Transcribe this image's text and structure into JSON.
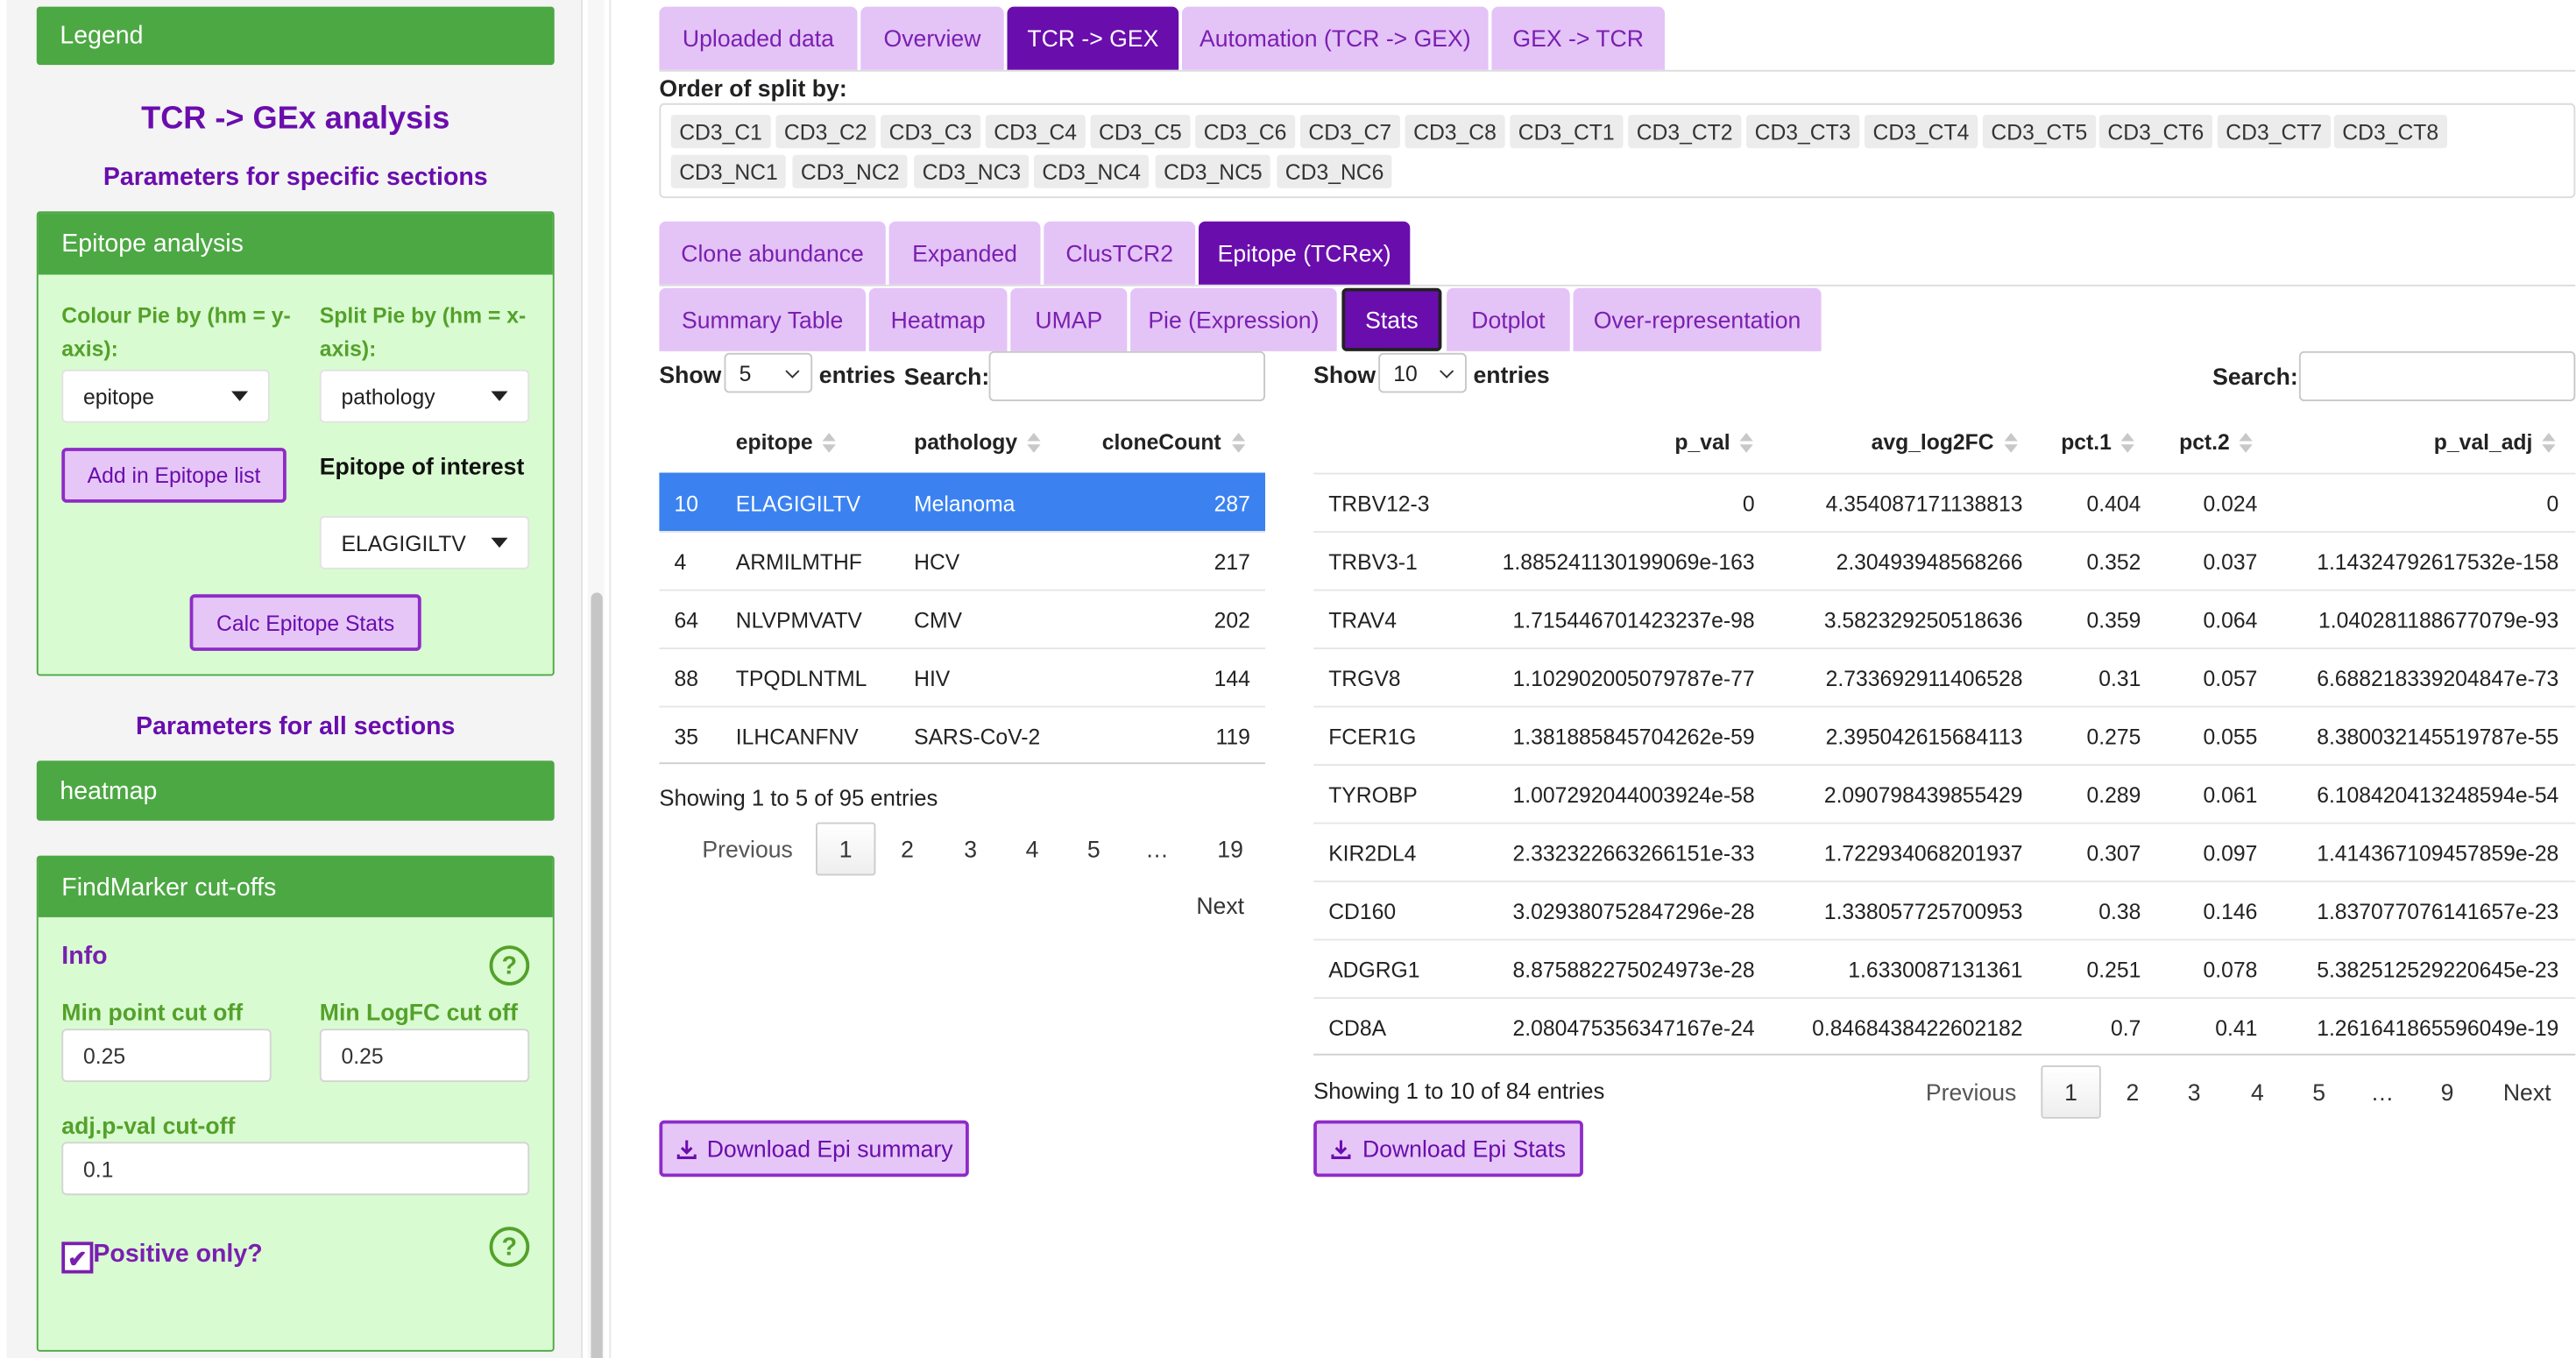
{
  "sidebar": {
    "legend_label": "Legend",
    "title": "TCR -> GEx analysis",
    "specific_params_label": "Parameters for specific sections",
    "epitope_box": {
      "header": "Epitope analysis",
      "colour_pie_label": "Colour Pie by (hm = y-axis):",
      "colour_pie_value": "epitope",
      "split_pie_label": "Split Pie by (hm = x-axis):",
      "split_pie_value": "pathology",
      "add_epitope_button": "Add in Epitope list",
      "epitope_interest_label": "Epitope of interest",
      "epitope_interest_value": "ELAGIGILTV",
      "calc_button": "Calc Epitope Stats"
    },
    "all_params_label": "Parameters for all sections",
    "heatmap_label": "heatmap",
    "findmarker_box": {
      "header": "FindMarker cut-offs",
      "info_label": "Info",
      "help_glyph": "?",
      "min_point_label": "Min point cut off",
      "min_point_value": "0.25",
      "min_logfc_label": "Min LogFC cut off",
      "min_logfc_value": "0.25",
      "adj_pval_label": "adj.p-val cut-off",
      "adj_pval_value": "0.1",
      "positive_only_label": "Positive only?",
      "positive_only_checked": true,
      "check_glyph": "✔"
    }
  },
  "main": {
    "top_tabs": [
      {
        "label": "Uploaded data",
        "active": false
      },
      {
        "label": "Overview",
        "active": false
      },
      {
        "label": "TCR -> GEX",
        "active": true
      },
      {
        "label": "Automation (TCR -> GEX)",
        "active": false
      },
      {
        "label": "GEX -> TCR",
        "active": false
      }
    ],
    "split_order_label": "Order of split by:",
    "split_chips": [
      "CD3_C1",
      "CD3_C2",
      "CD3_C3",
      "CD3_C4",
      "CD3_C5",
      "CD3_C6",
      "CD3_C7",
      "CD3_C8",
      "CD3_CT1",
      "CD3_CT2",
      "CD3_CT3",
      "CD3_CT4",
      "CD3_CT5",
      "CD3_CT6",
      "CD3_CT7",
      "CD3_CT8",
      "CD3_NC1",
      "CD3_NC2",
      "CD3_NC3",
      "CD3_NC4",
      "CD3_NC5",
      "CD3_NC6"
    ],
    "section_tabs": [
      {
        "label": "Clone abundance",
        "active": false
      },
      {
        "label": "Expanded",
        "active": false
      },
      {
        "label": "ClusTCR2",
        "active": false
      },
      {
        "label": "Epitope (TCRex)",
        "active": true
      }
    ],
    "sub_tabs": [
      {
        "label": "Summary Table",
        "active": false
      },
      {
        "label": "Heatmap",
        "active": false
      },
      {
        "label": "UMAP",
        "active": false
      },
      {
        "label": "Pie (Expression)",
        "active": false
      },
      {
        "label": "Stats",
        "active": true
      },
      {
        "label": "Dotplot",
        "active": false
      },
      {
        "label": "Over-representation",
        "active": false
      }
    ],
    "summary_table": {
      "show_label": "Show",
      "show_value": "5",
      "entries_label": "entries",
      "search_label": "Search:",
      "columns": [
        "epitope",
        "pathology",
        "cloneCount"
      ],
      "rows": [
        {
          "id": "10",
          "epitope": "ELAGIGILTV",
          "pathology": "Melanoma",
          "count": "287",
          "selected": true
        },
        {
          "id": "4",
          "epitope": "ARMILMTHF",
          "pathology": "HCV",
          "count": "217",
          "selected": false
        },
        {
          "id": "64",
          "epitope": "NLVPMVATV",
          "pathology": "CMV",
          "count": "202",
          "selected": false
        },
        {
          "id": "88",
          "epitope": "TPQDLNTML",
          "pathology": "HIV",
          "count": "144",
          "selected": false
        },
        {
          "id": "35",
          "epitope": "ILHCANFNV",
          "pathology": "SARS-CoV-2",
          "count": "119",
          "selected": false
        }
      ],
      "info": "Showing 1 to 5 of 95 entries",
      "pagination": {
        "previous": "Previous",
        "pages": [
          "1",
          "2",
          "3",
          "4",
          "5",
          "…",
          "19"
        ],
        "next": "Next",
        "current": "1"
      },
      "download_button": "Download Epi summary"
    },
    "stats_table": {
      "show_label": "Show",
      "show_value": "10",
      "entries_label": "entries",
      "search_label": "Search:",
      "columns": [
        "p_val",
        "avg_log2FC",
        "pct.1",
        "pct.2",
        "p_val_adj"
      ],
      "rows": [
        {
          "gene": "TRBV12-3",
          "p_val": "0",
          "avg_log2FC": "4.354087171138813",
          "pct1": "0.404",
          "pct2": "0.024",
          "p_val_adj": "0"
        },
        {
          "gene": "TRBV3-1",
          "p_val": "1.885241130199069e-163",
          "avg_log2FC": "2.30493948568266",
          "pct1": "0.352",
          "pct2": "0.037",
          "p_val_adj": "1.14324792617532e-158"
        },
        {
          "gene": "TRAV4",
          "p_val": "1.715446701423237e-98",
          "avg_log2FC": "3.582329250518636",
          "pct1": "0.359",
          "pct2": "0.064",
          "p_val_adj": "1.040281188677079e-93"
        },
        {
          "gene": "TRGV8",
          "p_val": "1.102902005079787e-77",
          "avg_log2FC": "2.733692911406528",
          "pct1": "0.31",
          "pct2": "0.057",
          "p_val_adj": "6.688218339204847e-73"
        },
        {
          "gene": "FCER1G",
          "p_val": "1.381885845704262e-59",
          "avg_log2FC": "2.395042615684113",
          "pct1": "0.275",
          "pct2": "0.055",
          "p_val_adj": "8.380032145519787e-55"
        },
        {
          "gene": "TYROBP",
          "p_val": "1.007292044003924e-58",
          "avg_log2FC": "2.090798439855429",
          "pct1": "0.289",
          "pct2": "0.061",
          "p_val_adj": "6.108420413248594e-54"
        },
        {
          "gene": "KIR2DL4",
          "p_val": "2.332322663266151e-33",
          "avg_log2FC": "1.722934068201937",
          "pct1": "0.307",
          "pct2": "0.097",
          "p_val_adj": "1.414367109457859e-28"
        },
        {
          "gene": "CD160",
          "p_val": "3.029380752847296e-28",
          "avg_log2FC": "1.338057725700953",
          "pct1": "0.38",
          "pct2": "0.146",
          "p_val_adj": "1.837077076141657e-23"
        },
        {
          "gene": "ADGRG1",
          "p_val": "8.875882275024973e-28",
          "avg_log2FC": "1.6330087131361",
          "pct1": "0.251",
          "pct2": "0.078",
          "p_val_adj": "5.382512529220645e-23"
        },
        {
          "gene": "CD8A",
          "p_val": "2.080475356347167e-24",
          "avg_log2FC": "0.8468438422602182",
          "pct1": "0.7",
          "pct2": "0.41",
          "p_val_adj": "1.261641865596049e-19"
        }
      ],
      "info": "Showing 1 to 10 of 84 entries",
      "pagination": {
        "previous": "Previous",
        "pages": [
          "1",
          "2",
          "3",
          "4",
          "5",
          "…",
          "9"
        ],
        "next": "Next",
        "current": "1"
      },
      "download_button": "Download Epi Stats"
    }
  },
  "colors": {
    "purple": "#6a0dad",
    "light_purple": "#e4c3f7",
    "green": "#4ca843",
    "light_green": "#d9fbd1",
    "selected_row": "#3b82f0"
  }
}
